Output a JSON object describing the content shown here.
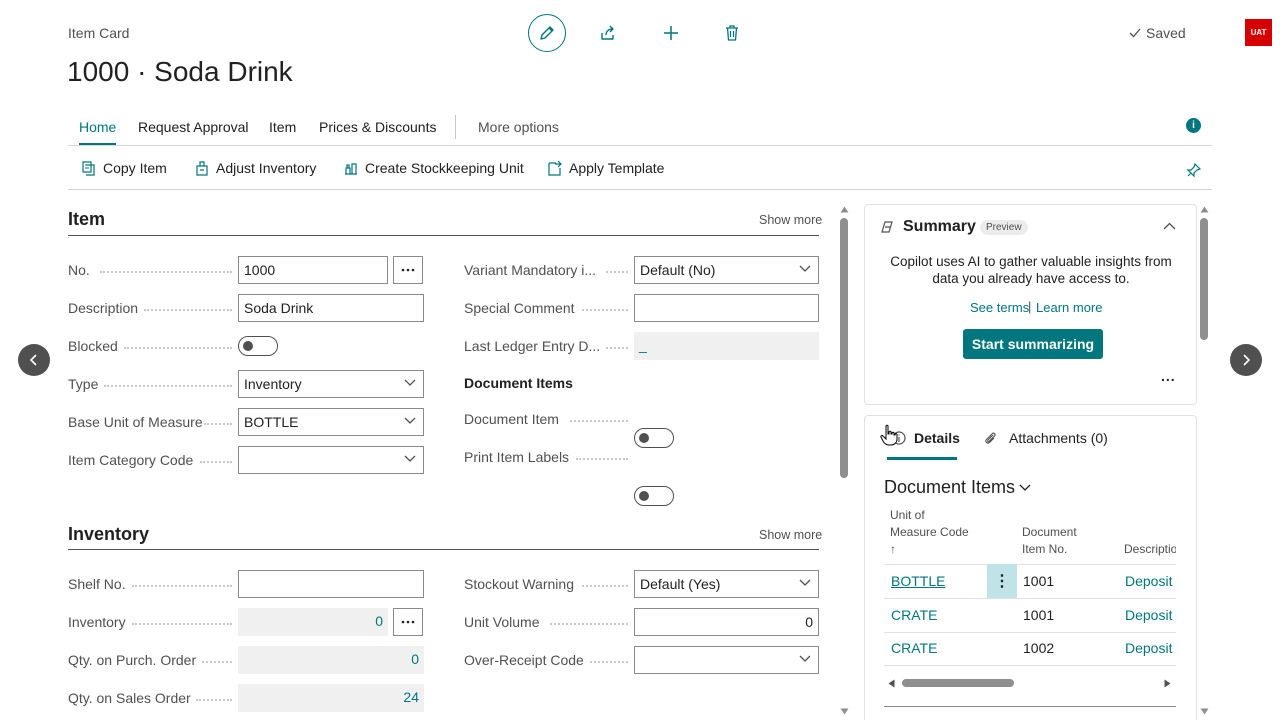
{
  "header": {
    "breadcrumb": "Item Card",
    "title": "1000 · Soda Drink",
    "saved_label": "Saved",
    "env_badge": "UAT"
  },
  "nav_tabs": [
    "Home",
    "Request Approval",
    "Item",
    "Prices & Discounts",
    "More options"
  ],
  "info_icon": "i",
  "actions": [
    {
      "label": "Copy Item",
      "icon": "copy-icon"
    },
    {
      "label": "Adjust Inventory",
      "icon": "adjust-inventory-icon"
    },
    {
      "label": "Create Stockkeeping Unit",
      "icon": "stockkeeping-icon"
    },
    {
      "label": "Apply Template",
      "icon": "template-icon"
    }
  ],
  "item_section": {
    "title": "Item",
    "show_more": "Show more",
    "left_fields": {
      "no": {
        "label": "No.",
        "value": "1000"
      },
      "description": {
        "label": "Description",
        "value": "Soda Drink"
      },
      "blocked": {
        "label": "Blocked",
        "value": "off"
      },
      "type": {
        "label": "Type",
        "value": "Inventory"
      },
      "base_uom": {
        "label": "Base Unit of Measure",
        "value": "BOTTLE"
      },
      "item_category": {
        "label": "Item Category Code",
        "value": ""
      }
    },
    "right_fields": {
      "variant_mandatory": {
        "label": "Variant Mandatory i...",
        "value": "Default (No)"
      },
      "special_comment": {
        "label": "Special Comment",
        "value": ""
      },
      "last_ledger": {
        "label": "Last Ledger Entry D...",
        "value": "_"
      },
      "document_items_heading": "Document Items",
      "document_item": {
        "label": "Document Item",
        "value": "off"
      },
      "print_item_labels": {
        "label": "Print Item Labels",
        "value": "off"
      }
    }
  },
  "inventory_section": {
    "title": "Inventory",
    "show_more": "Show more",
    "left_fields": {
      "shelf_no": {
        "label": "Shelf No.",
        "value": ""
      },
      "inventory": {
        "label": "Inventory",
        "value": "0"
      },
      "qty_purch": {
        "label": "Qty. on Purch. Order",
        "value": "0"
      },
      "qty_sales": {
        "label": "Qty. on Sales Order",
        "value": "24"
      }
    },
    "right_fields": {
      "stockout_warning": {
        "label": "Stockout Warning",
        "value": "Default (Yes)"
      },
      "unit_volume": {
        "label": "Unit Volume",
        "value": "0"
      },
      "over_receipt": {
        "label": "Over-Receipt Code",
        "value": ""
      }
    }
  },
  "summary_card": {
    "title": "Summary",
    "badge": "Preview",
    "text_line1": "Copilot uses AI to gather valuable insights from",
    "text_line2": "data you already have access to.",
    "see_terms": "See terms",
    "separator": "|",
    "learn_more": "Learn more",
    "button": "Start summarizing",
    "more": "..."
  },
  "details_card": {
    "tabs": [
      "Details",
      "Attachments (0)"
    ],
    "heading": "Document Items",
    "columns": {
      "uom_line1": "Unit of",
      "uom_line2": "Measure Code",
      "uom_sort": "↑",
      "docno_line1": "Document",
      "docno_line2": "Item No.",
      "desc": "Descriptio"
    },
    "rows": [
      {
        "uom": "BOTTLE",
        "doc_no": "1001",
        "desc": "Deposit"
      },
      {
        "uom": "CRATE",
        "doc_no": "1001",
        "desc": "Deposit"
      },
      {
        "uom": "CRATE",
        "doc_no": "1002",
        "desc": "Deposit"
      }
    ],
    "row_menu": "⋮"
  },
  "colors": {
    "accent": "#00767f",
    "env_badge": "#d60000"
  }
}
